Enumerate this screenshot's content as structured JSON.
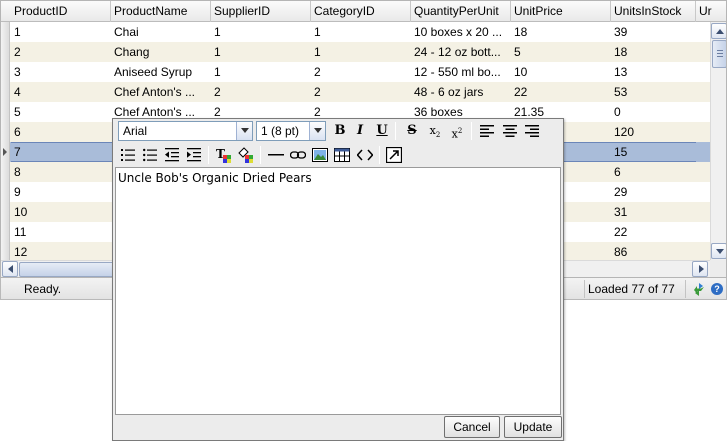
{
  "grid": {
    "columns": [
      "ProductID",
      "ProductName",
      "SupplierID",
      "CategoryID",
      "QuantityPerUnit",
      "UnitPrice",
      "UnitsInStock",
      "Ur"
    ],
    "rows": [
      [
        "1",
        "Chai",
        "1",
        "1",
        "10 boxes x 20 ...",
        "18",
        "39"
      ],
      [
        "2",
        "Chang",
        "1",
        "1",
        "24 - 12 oz bott...",
        "5",
        "18"
      ],
      [
        "3",
        "Aniseed Syrup",
        "1",
        "2",
        "12 - 550 ml bo...",
        "10",
        "13"
      ],
      [
        "4",
        "Chef Anton's ...",
        "2",
        "2",
        "48 - 6 oz jars",
        "22",
        "53"
      ],
      [
        "5",
        "Chef Anton's ...",
        "2",
        "2",
        "36 boxes",
        "21.35",
        "0"
      ],
      [
        "6",
        "",
        "",
        "",
        "",
        "",
        "120"
      ],
      [
        "7",
        "",
        "",
        "",
        "",
        "",
        "15"
      ],
      [
        "8",
        "",
        "",
        "",
        "",
        "",
        "6"
      ],
      [
        "9",
        "",
        "",
        "",
        "",
        "",
        "29"
      ],
      [
        "10",
        "",
        "",
        "",
        "",
        "",
        "31"
      ],
      [
        "11",
        "",
        "",
        "",
        "",
        "",
        "22"
      ],
      [
        "12",
        "",
        "",
        "",
        "",
        "",
        "86"
      ]
    ],
    "selected_row": 7
  },
  "status": {
    "text": "Ready.",
    "loaded": "Loaded 77 of 77"
  },
  "editor": {
    "font_family": "Arial",
    "font_size": "1 (8 pt)",
    "content": "Uncle Bob's Organic Dried Pears",
    "cancel_label": "Cancel",
    "update_label": "Update",
    "toolbar_icons": [
      "bold-icon",
      "italic-icon",
      "underline-icon",
      "strikethrough-icon",
      "subscript-icon",
      "superscript-icon",
      "align-left-icon",
      "align-center-icon",
      "align-right-icon",
      "ordered-list-icon",
      "unordered-list-icon",
      "outdent-icon",
      "indent-icon",
      "text-color-icon",
      "background-color-icon",
      "horizontal-rule-icon",
      "link-icon",
      "image-icon",
      "table-icon",
      "html-source-icon",
      "fullscreen-icon"
    ]
  },
  "colors": {
    "row_alt": "#f4f1e4",
    "row_selected": "#a9bcd9",
    "scroll_accent": "#3b4e70"
  }
}
